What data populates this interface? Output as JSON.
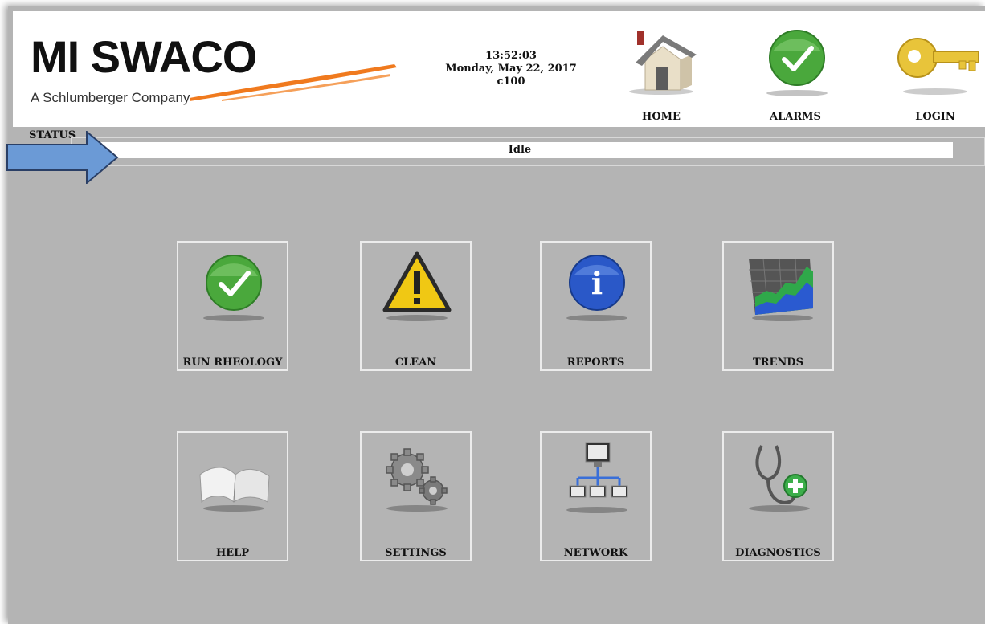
{
  "header": {
    "logo": {
      "brand": "MI SWACO",
      "tagline": "A Schlumberger Company"
    },
    "time": "13:52:03",
    "date": "Monday, May 22, 2017",
    "device": "c100",
    "nav": [
      {
        "label": "HOME",
        "icon": "house-icon"
      },
      {
        "label": "ALARMS",
        "icon": "checkmark-icon"
      },
      {
        "label": "LOGIN",
        "icon": "key-icon"
      }
    ]
  },
  "status": {
    "label": "STATUS",
    "value": "Idle"
  },
  "tiles": [
    {
      "label": "RUN RHEOLOGY",
      "icon": "checkmark-icon"
    },
    {
      "label": "CLEAN",
      "icon": "warning-icon"
    },
    {
      "label": "REPORTS",
      "icon": "info-icon"
    },
    {
      "label": "TRENDS",
      "icon": "chart-icon"
    },
    {
      "label": "HELP",
      "icon": "book-icon"
    },
    {
      "label": "SETTINGS",
      "icon": "gears-icon"
    },
    {
      "label": "NETWORK",
      "icon": "network-icon"
    },
    {
      "label": "DIAGNOSTICS",
      "icon": "stethoscope-icon"
    }
  ],
  "colors": {
    "background": "#b4b4b4",
    "header": "#ffffff",
    "accent_orange": "#f07a1e",
    "arrow_blue": "#6b9ad6"
  }
}
